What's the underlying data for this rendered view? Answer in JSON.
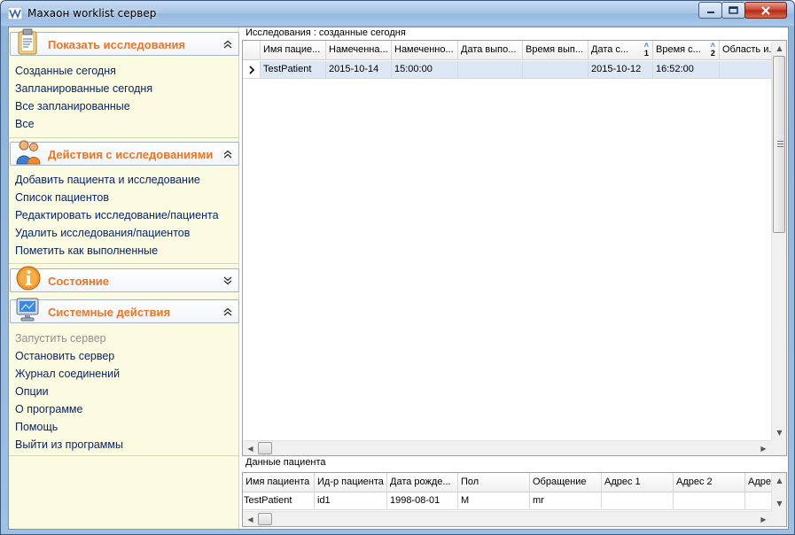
{
  "window": {
    "title": "Maxaoн worklist сервер"
  },
  "sidebar": {
    "groups": [
      {
        "title": "Показать исследования",
        "icon": "clipboard-icon",
        "expanded": true,
        "items": [
          "Созданные сегодня",
          "Запланированные сегодня",
          "Все запланированные",
          "Все"
        ]
      },
      {
        "title": "Действия с исследованиями",
        "icon": "users-icon",
        "expanded": true,
        "items": [
          "Добавить пациента и исследование",
          "Список пациентов",
          "Редактировать исследование/пациента",
          "Удалить исследования/пациентов",
          "Пометить как выполненные"
        ]
      },
      {
        "title": "Состояние",
        "icon": "info-icon",
        "expanded": false,
        "items": []
      },
      {
        "title": "Системные действия",
        "icon": "monitor-icon",
        "expanded": true,
        "items": [
          "Запустить сервер",
          "Остановить сервер",
          "Журнал соединений",
          "Опции",
          "О программе",
          "Помощь",
          "Выйти из программы"
        ],
        "disabled_items": [
          "Запустить сервер"
        ]
      }
    ]
  },
  "studies": {
    "title": "Исследования : созданные сегодня",
    "columns": [
      "Имя пациента",
      "Намеченная дата",
      "Намеченное время",
      "Дата выполнения",
      "Время выполнения",
      "Дата создания",
      "Время создания",
      "Область исследования"
    ],
    "columns_display": [
      "Имя пациe...",
      "Намеченна...",
      "Намеченно...",
      "Дата выпо...",
      "Время вып...",
      "Дата с...",
      "Время с...",
      "Область и..."
    ],
    "sort_marks": {
      "5": "1",
      "6": "2"
    },
    "rows": [
      [
        "TestPatient",
        "2015-10-14",
        "15:00:00",
        "",
        "",
        "2015-10-12",
        "16:52:00",
        ""
      ]
    ]
  },
  "patient": {
    "title": "Данные пациента",
    "columns": [
      "Имя пациента",
      "Ид-р пациента",
      "Дата рожде...",
      "Пол",
      "Обращение",
      "Адрес 1",
      "Адрес 2",
      "Адре"
    ],
    "rows": [
      [
        "TestPatient",
        "id1",
        "1998-08-01",
        "M",
        "mr",
        "",
        "",
        ""
      ]
    ]
  },
  "colors": {
    "accent": "#f07421",
    "link": "#0a246a",
    "sidebar_bg": "#fbfbe2",
    "selection": "#dde8f7"
  }
}
